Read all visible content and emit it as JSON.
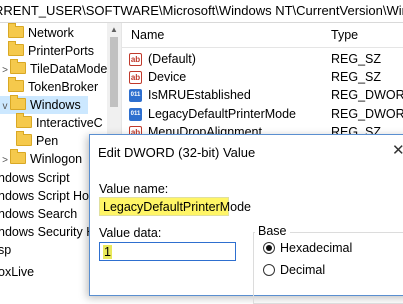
{
  "address_bar": {
    "path": "RRENT_USER\\SOFTWARE\\Microsoft\\Windows NT\\CurrentVersion\\Windows"
  },
  "tree": {
    "items": [
      {
        "label": "Network",
        "indent": 0,
        "chevron": ""
      },
      {
        "label": "PrinterPorts",
        "indent": 0,
        "chevron": ""
      },
      {
        "label": "TileDataModel",
        "indent": 0,
        "chevron": ">"
      },
      {
        "label": "TokenBroker",
        "indent": 0,
        "chevron": ""
      },
      {
        "label": "Windows",
        "indent": 0,
        "chevron": "v",
        "selected": true
      },
      {
        "label": "InteractiveC",
        "indent": 1,
        "chevron": ""
      },
      {
        "label": "Pen",
        "indent": 1,
        "chevron": ""
      },
      {
        "label": "Winlogon",
        "indent": 0,
        "chevron": ">"
      },
      {
        "label": "ndows Script",
        "indent": -1,
        "chevron": ""
      },
      {
        "label": "ndows Script Ho",
        "indent": -1,
        "chevron": ""
      },
      {
        "label": "ndows Search",
        "indent": -1,
        "chevron": ""
      },
      {
        "label": "ndows Security H",
        "indent": -1,
        "chevron": ""
      },
      {
        "label": "sp",
        "indent": -1,
        "chevron": ""
      },
      {
        "label": "oxLive",
        "indent": -1,
        "chevron": ""
      }
    ]
  },
  "list": {
    "headers": {
      "name": "Name",
      "type": "Type"
    },
    "rows": [
      {
        "icon": "string-value-icon",
        "name": "(Default)",
        "type": "REG_SZ"
      },
      {
        "icon": "string-value-icon",
        "name": "Device",
        "type": "REG_SZ"
      },
      {
        "icon": "dword-value-icon",
        "name": "IsMRUEstablished",
        "type": "REG_DWORD"
      },
      {
        "icon": "dword-value-icon",
        "name": "LegacyDefaultPrinterMode",
        "type": "REG_DWORD"
      },
      {
        "icon": "string-value-icon",
        "name": "MenuDropAlignment",
        "type": "REG_SZ"
      }
    ]
  },
  "dialog": {
    "title": "Edit DWORD (32-bit) Value",
    "close_glyph": "✕",
    "value_name_label": "Value name:",
    "value_name": "LegacyDefaultPrinterMode",
    "value_data_label": "Value data:",
    "value_data": "1",
    "base_label": "Base",
    "base_options": [
      "Hexadecimal",
      "Decimal"
    ],
    "base_selected": "Hexadecimal"
  },
  "colors": {
    "highlight": "#fff566",
    "selection": "#cce8ff"
  }
}
